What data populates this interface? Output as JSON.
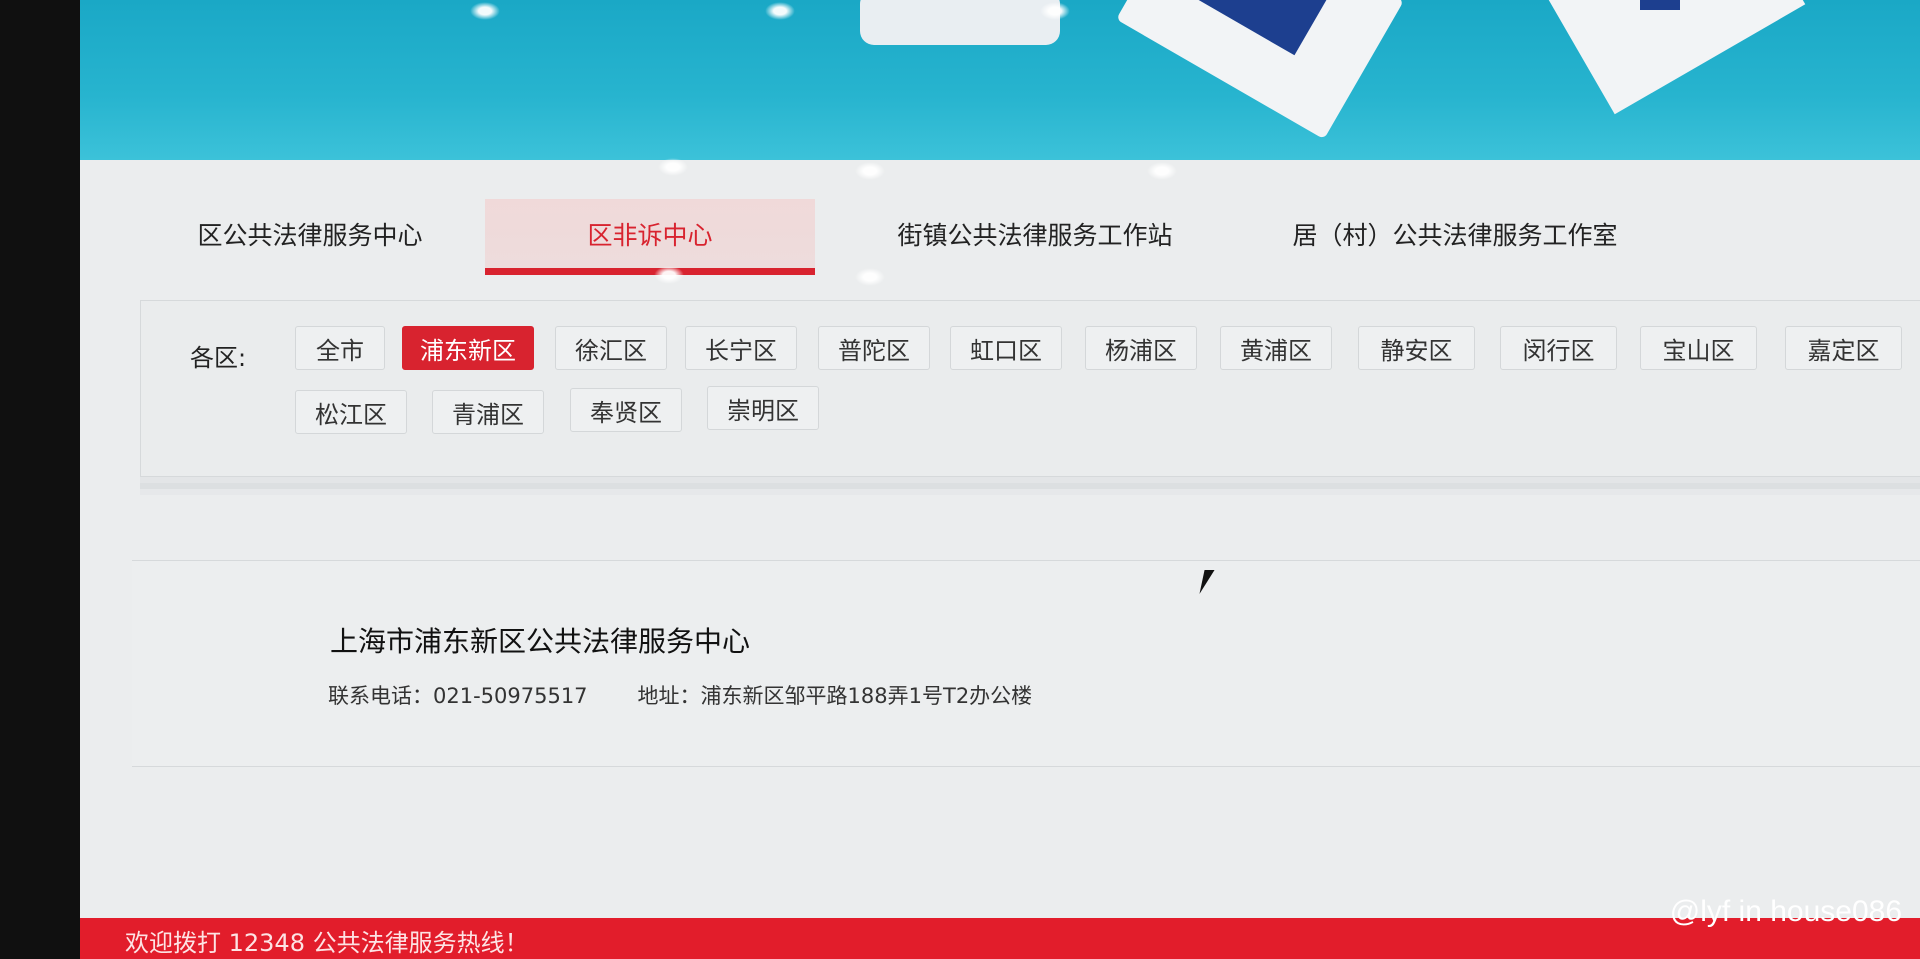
{
  "tabs": [
    {
      "label": "区公共法律服务中心",
      "active": false
    },
    {
      "label": "区非诉中心",
      "active": true
    },
    {
      "label": "街镇公共法律服务工作站",
      "active": false
    },
    {
      "label": "居（村）公共法律服务工作室",
      "active": false
    }
  ],
  "districts": {
    "label": "各区:",
    "items": [
      {
        "label": "全市",
        "active": false
      },
      {
        "label": "浦东新区",
        "active": true
      },
      {
        "label": "徐汇区",
        "active": false
      },
      {
        "label": "长宁区",
        "active": false
      },
      {
        "label": "普陀区",
        "active": false
      },
      {
        "label": "虹口区",
        "active": false
      },
      {
        "label": "杨浦区",
        "active": false
      },
      {
        "label": "黄浦区",
        "active": false
      },
      {
        "label": "静安区",
        "active": false
      },
      {
        "label": "闵行区",
        "active": false
      },
      {
        "label": "宝山区",
        "active": false
      },
      {
        "label": "嘉定区",
        "active": false
      },
      {
        "label": "松江区",
        "active": false
      },
      {
        "label": "青浦区",
        "active": false
      },
      {
        "label": "奉贤区",
        "active": false
      },
      {
        "label": "崇明区",
        "active": false
      }
    ]
  },
  "result": {
    "title": "上海市浦东新区公共法律服务中心",
    "phone_label": "联系电话：",
    "phone": "021-50975517",
    "address_label": "地址：",
    "address": "浦东新区邹平路188弄1号T2办公楼"
  },
  "footer": {
    "text": "欢迎拨打 12348 公共法律服务热线！"
  },
  "watermark": "@lyf in house086",
  "colors": {
    "accent": "#d8232f",
    "banner": "#27b4cf",
    "footer": "#e21d2b"
  }
}
